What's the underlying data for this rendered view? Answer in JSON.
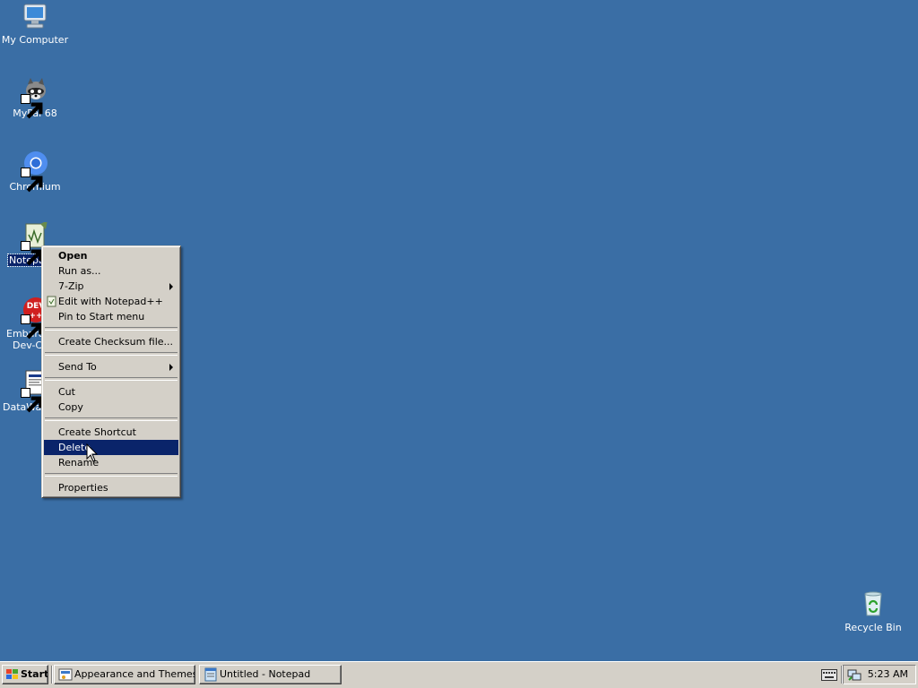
{
  "desktop": {
    "background": "#3a6ea5",
    "icons": [
      {
        "id": "my-computer",
        "label": "My Computer",
        "icon": "computer-icon"
      },
      {
        "id": "mypal",
        "label": "MyPal 68",
        "icon": "raccoon-icon"
      },
      {
        "id": "chromium",
        "label": "Chromium",
        "icon": "chromium-icon"
      },
      {
        "id": "notepad",
        "label": "Notepa",
        "icon": "notepad-plus-icon"
      },
      {
        "id": "embarcadero",
        "label_line1": "Embarca",
        "label_line2": "Dev-C",
        "icon": "devcpp-icon"
      },
      {
        "id": "datawag",
        "label": "DataWag",
        "icon": "document-icon"
      },
      {
        "id": "recycle-bin",
        "label": "Recycle Bin",
        "icon": "recycle-bin-icon"
      }
    ]
  },
  "context_menu": {
    "items": [
      {
        "label": "Open",
        "bold": true
      },
      {
        "label": "Run as..."
      },
      {
        "label": "7-Zip",
        "submenu": true
      },
      {
        "label": "Edit with Notepad++",
        "icon": "notepad-plus-icon"
      },
      {
        "label": "Pin to Start menu"
      },
      {
        "separator": true
      },
      {
        "label": "Create Checksum file..."
      },
      {
        "separator": true
      },
      {
        "label": "Send To",
        "submenu": true
      },
      {
        "separator": true
      },
      {
        "label": "Cut"
      },
      {
        "label": "Copy"
      },
      {
        "separator": true
      },
      {
        "label": "Create Shortcut"
      },
      {
        "label": "Delete",
        "highlighted": true
      },
      {
        "label": "Rename"
      },
      {
        "separator": true
      },
      {
        "label": "Properties"
      }
    ],
    "highlight_color": "#0a246a"
  },
  "taskbar": {
    "start_label": "Start",
    "tasks": [
      {
        "label": "Appearance and Themes",
        "icon": "control-panel-icon"
      },
      {
        "label": "Untitled - Notepad",
        "icon": "notepad-icon"
      }
    ],
    "clock": "5:23 AM"
  }
}
